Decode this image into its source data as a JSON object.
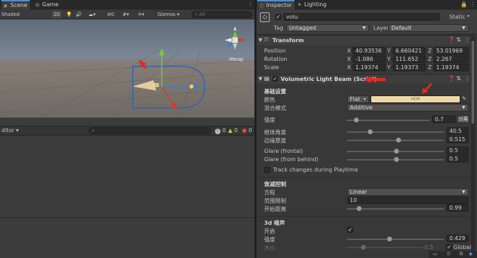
{
  "scene_tabs": {
    "scene": "Scene",
    "game": "Game"
  },
  "scene_toolbar": {
    "shading": "Shaded",
    "mode_2d": "2D",
    "effects_count": "0",
    "gizmos": "Gizmos",
    "search_placeholder": "All"
  },
  "persp_label": "‹Persp",
  "bottom_panel": {
    "title": "ditor",
    "badge_info": "0",
    "badge_warn": "0",
    "badge_error": "0"
  },
  "inspector_tabs": {
    "inspector": "Inspector",
    "lighting": "Lighting"
  },
  "object": {
    "name": "volu",
    "static_label": "Static",
    "tag_label": "Tag",
    "tag_value": "Untagged",
    "layer_label": "Layer",
    "layer_value": "Default"
  },
  "transform": {
    "title": "Transform",
    "rows": [
      {
        "label": "Position",
        "x": "40.93536",
        "y": "6.660421",
        "z": "53.01969"
      },
      {
        "label": "Rotation",
        "x": "-1.086",
        "y": "111.652",
        "z": "2.267"
      },
      {
        "label": "Scale",
        "x": "1.19374",
        "y": "1.19373",
        "z": "1.19374"
      }
    ]
  },
  "script": {
    "title": "Volumetric Light Beam (Script)",
    "basic_header": "基础设置",
    "color_label": "颜色",
    "color_mode": "Flat",
    "hdr_label": "HDR",
    "color_swatch": "#f0d8a6",
    "blend_label": "混合模式",
    "blend_value": "Additive",
    "intensity_label": "强度",
    "intensity_value": "0.7",
    "separate_btn": "分离",
    "sliders": [
      {
        "label": "根体角度",
        "value": "40.5",
        "fraction": 0.22
      },
      {
        "label": "边缘厚度",
        "value": "0.515",
        "fraction": 0.52
      },
      {
        "label": "Glare (frontal)",
        "value": "0.5",
        "fraction": 0.5
      },
      {
        "label": "Glare (from behind)",
        "value": "0.5",
        "fraction": 0.5
      }
    ],
    "track_label": "Track changes during Playtime",
    "atten_header": "衰减控制",
    "equation_label": "方程",
    "equation_value": "Linear",
    "range_label": "范围限制",
    "range_value": "10",
    "start_label": "开始距离",
    "start_value": "0.99",
    "start_fraction": 0.1,
    "noise_header": "3d 噪声",
    "enable_label": "开启",
    "noise_intensity_label": "强度",
    "noise_intensity_value": "0.429",
    "noise_intensity_fraction": 0.43,
    "size_label": "大小",
    "size_value": "0.5",
    "global_label": "Global"
  },
  "colors": {
    "accent": "#4e8fd5",
    "arrow": "#e8281c",
    "x_axis": "#d63b2b",
    "y_axis": "#7ac93a",
    "z_axis": "#3a7ad6"
  }
}
